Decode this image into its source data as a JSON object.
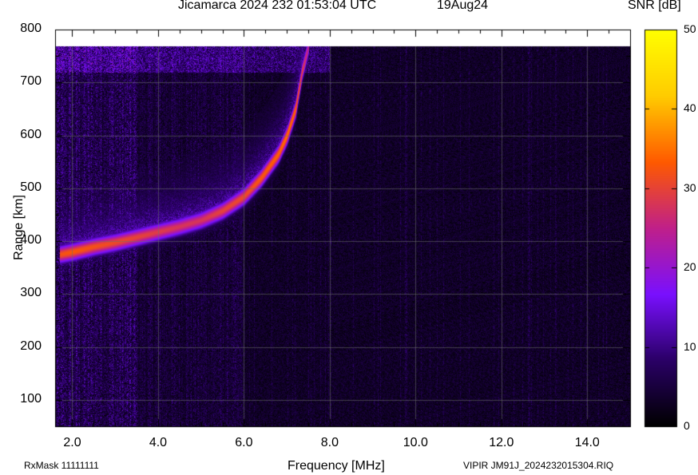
{
  "header": {
    "title": "Jicamarca 2024 232 01:53:04 UTC",
    "date": "19Aug24"
  },
  "colorbar": {
    "label": "SNR [dB]",
    "ticks": [
      "0",
      "10",
      "20",
      "30",
      "40",
      "50"
    ],
    "range": [
      0,
      50
    ],
    "colormap": [
      "#000000",
      "#2a0066",
      "#7a10ff",
      "#c0208a",
      "#ff5a00",
      "#ffcc00",
      "#ffff00"
    ]
  },
  "footer": {
    "left": "RxMask 11111111",
    "right": "VIPIR  JM91J_2024232015304.RIQ"
  },
  "chart_data": {
    "type": "heatmap",
    "title": "Jicamarca 2024 232 01:53:04 UTC",
    "xlabel": "Frequency [MHz]",
    "ylabel": "Range [km]",
    "xlim": [
      1.6,
      15.0
    ],
    "ylim": [
      50,
      800
    ],
    "xticks": [
      "2.0",
      "4.0",
      "6.0",
      "8.0",
      "10.0",
      "12.0",
      "14.0"
    ],
    "xtick_values": [
      2,
      4,
      6,
      8,
      10,
      12,
      14
    ],
    "yticks": [
      "100",
      "200",
      "300",
      "400",
      "500",
      "600",
      "700",
      "800"
    ],
    "ytick_values": [
      100,
      200,
      300,
      400,
      500,
      600,
      700,
      800
    ],
    "data_top_km": 768,
    "grid": true,
    "trace": {
      "name": "ionogram-echo",
      "points": [
        {
          "f": 1.7,
          "range": 375,
          "snr": 32
        },
        {
          "f": 2.0,
          "range": 380,
          "snr": 33
        },
        {
          "f": 2.5,
          "range": 390,
          "snr": 32
        },
        {
          "f": 3.0,
          "range": 398,
          "snr": 31
        },
        {
          "f": 3.5,
          "range": 408,
          "snr": 30
        },
        {
          "f": 4.0,
          "range": 418,
          "snr": 29
        },
        {
          "f": 4.5,
          "range": 428,
          "snr": 28
        },
        {
          "f": 5.0,
          "range": 440,
          "snr": 28
        },
        {
          "f": 5.5,
          "range": 458,
          "snr": 30
        },
        {
          "f": 6.0,
          "range": 485,
          "snr": 31
        },
        {
          "f": 6.4,
          "range": 520,
          "snr": 33
        },
        {
          "f": 6.8,
          "range": 565,
          "snr": 34
        },
        {
          "f": 7.0,
          "range": 600,
          "snr": 35
        },
        {
          "f": 7.2,
          "range": 650,
          "snr": 34
        },
        {
          "f": 7.35,
          "range": 720,
          "snr": 30
        },
        {
          "f": 7.5,
          "range": 768,
          "snr": 25
        }
      ]
    }
  }
}
